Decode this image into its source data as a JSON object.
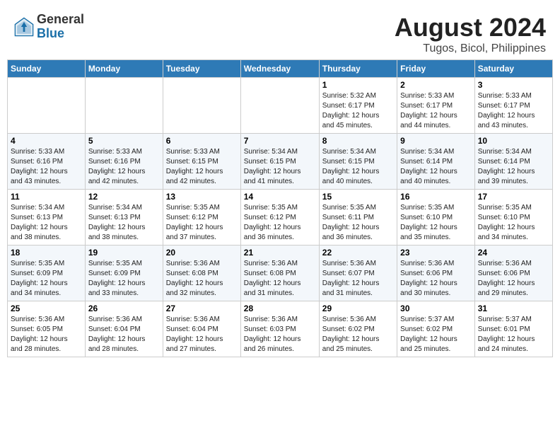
{
  "header": {
    "logo_line1": "General",
    "logo_line2": "Blue",
    "title": "August 2024",
    "subtitle": "Tugos, Bicol, Philippines"
  },
  "calendar": {
    "weekdays": [
      "Sunday",
      "Monday",
      "Tuesday",
      "Wednesday",
      "Thursday",
      "Friday",
      "Saturday"
    ],
    "weeks": [
      [
        {
          "day": "",
          "info": ""
        },
        {
          "day": "",
          "info": ""
        },
        {
          "day": "",
          "info": ""
        },
        {
          "day": "",
          "info": ""
        },
        {
          "day": "1",
          "info": "Sunrise: 5:32 AM\nSunset: 6:17 PM\nDaylight: 12 hours\nand 45 minutes."
        },
        {
          "day": "2",
          "info": "Sunrise: 5:33 AM\nSunset: 6:17 PM\nDaylight: 12 hours\nand 44 minutes."
        },
        {
          "day": "3",
          "info": "Sunrise: 5:33 AM\nSunset: 6:17 PM\nDaylight: 12 hours\nand 43 minutes."
        }
      ],
      [
        {
          "day": "4",
          "info": "Sunrise: 5:33 AM\nSunset: 6:16 PM\nDaylight: 12 hours\nand 43 minutes."
        },
        {
          "day": "5",
          "info": "Sunrise: 5:33 AM\nSunset: 6:16 PM\nDaylight: 12 hours\nand 42 minutes."
        },
        {
          "day": "6",
          "info": "Sunrise: 5:33 AM\nSunset: 6:15 PM\nDaylight: 12 hours\nand 42 minutes."
        },
        {
          "day": "7",
          "info": "Sunrise: 5:34 AM\nSunset: 6:15 PM\nDaylight: 12 hours\nand 41 minutes."
        },
        {
          "day": "8",
          "info": "Sunrise: 5:34 AM\nSunset: 6:15 PM\nDaylight: 12 hours\nand 40 minutes."
        },
        {
          "day": "9",
          "info": "Sunrise: 5:34 AM\nSunset: 6:14 PM\nDaylight: 12 hours\nand 40 minutes."
        },
        {
          "day": "10",
          "info": "Sunrise: 5:34 AM\nSunset: 6:14 PM\nDaylight: 12 hours\nand 39 minutes."
        }
      ],
      [
        {
          "day": "11",
          "info": "Sunrise: 5:34 AM\nSunset: 6:13 PM\nDaylight: 12 hours\nand 38 minutes."
        },
        {
          "day": "12",
          "info": "Sunrise: 5:34 AM\nSunset: 6:13 PM\nDaylight: 12 hours\nand 38 minutes."
        },
        {
          "day": "13",
          "info": "Sunrise: 5:35 AM\nSunset: 6:12 PM\nDaylight: 12 hours\nand 37 minutes."
        },
        {
          "day": "14",
          "info": "Sunrise: 5:35 AM\nSunset: 6:12 PM\nDaylight: 12 hours\nand 36 minutes."
        },
        {
          "day": "15",
          "info": "Sunrise: 5:35 AM\nSunset: 6:11 PM\nDaylight: 12 hours\nand 36 minutes."
        },
        {
          "day": "16",
          "info": "Sunrise: 5:35 AM\nSunset: 6:10 PM\nDaylight: 12 hours\nand 35 minutes."
        },
        {
          "day": "17",
          "info": "Sunrise: 5:35 AM\nSunset: 6:10 PM\nDaylight: 12 hours\nand 34 minutes."
        }
      ],
      [
        {
          "day": "18",
          "info": "Sunrise: 5:35 AM\nSunset: 6:09 PM\nDaylight: 12 hours\nand 34 minutes."
        },
        {
          "day": "19",
          "info": "Sunrise: 5:35 AM\nSunset: 6:09 PM\nDaylight: 12 hours\nand 33 minutes."
        },
        {
          "day": "20",
          "info": "Sunrise: 5:36 AM\nSunset: 6:08 PM\nDaylight: 12 hours\nand 32 minutes."
        },
        {
          "day": "21",
          "info": "Sunrise: 5:36 AM\nSunset: 6:08 PM\nDaylight: 12 hours\nand 31 minutes."
        },
        {
          "day": "22",
          "info": "Sunrise: 5:36 AM\nSunset: 6:07 PM\nDaylight: 12 hours\nand 31 minutes."
        },
        {
          "day": "23",
          "info": "Sunrise: 5:36 AM\nSunset: 6:06 PM\nDaylight: 12 hours\nand 30 minutes."
        },
        {
          "day": "24",
          "info": "Sunrise: 5:36 AM\nSunset: 6:06 PM\nDaylight: 12 hours\nand 29 minutes."
        }
      ],
      [
        {
          "day": "25",
          "info": "Sunrise: 5:36 AM\nSunset: 6:05 PM\nDaylight: 12 hours\nand 28 minutes."
        },
        {
          "day": "26",
          "info": "Sunrise: 5:36 AM\nSunset: 6:04 PM\nDaylight: 12 hours\nand 28 minutes."
        },
        {
          "day": "27",
          "info": "Sunrise: 5:36 AM\nSunset: 6:04 PM\nDaylight: 12 hours\nand 27 minutes."
        },
        {
          "day": "28",
          "info": "Sunrise: 5:36 AM\nSunset: 6:03 PM\nDaylight: 12 hours\nand 26 minutes."
        },
        {
          "day": "29",
          "info": "Sunrise: 5:36 AM\nSunset: 6:02 PM\nDaylight: 12 hours\nand 25 minutes."
        },
        {
          "day": "30",
          "info": "Sunrise: 5:37 AM\nSunset: 6:02 PM\nDaylight: 12 hours\nand 25 minutes."
        },
        {
          "day": "31",
          "info": "Sunrise: 5:37 AM\nSunset: 6:01 PM\nDaylight: 12 hours\nand 24 minutes."
        }
      ]
    ]
  }
}
